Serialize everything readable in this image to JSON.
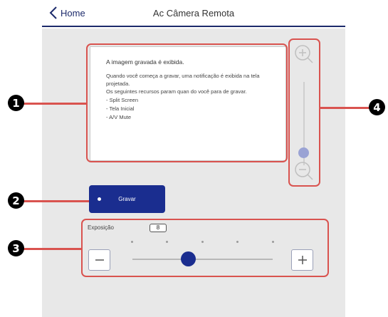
{
  "header": {
    "back_label": "Home",
    "title": "Ac Câmera Remota"
  },
  "preview": {
    "title": "A imagem gravada é exibida.",
    "line1": "Quando você começa a gravar, uma notificação é exibida na tela projetada.",
    "line2": "Os seguintes recursos param quan do você para de gravar.",
    "items": [
      "- Split Screen",
      "- Tela Inicial",
      "- A/V Mute"
    ]
  },
  "zoom": {
    "in_icon": "zoom-in-icon",
    "out_icon": "zoom-out-icon",
    "level": 0.15
  },
  "record": {
    "label": "Gravar"
  },
  "exposure": {
    "label": "Exposição",
    "value": "8",
    "minus_icon": "minus-icon",
    "plus_icon": "plus-icon",
    "slider_fraction": 0.4
  },
  "callouts": [
    "1",
    "2",
    "3",
    "4"
  ],
  "colors": {
    "accent": "#1a2d8f",
    "callout": "#d9534f",
    "background": "#e8e8e8"
  }
}
